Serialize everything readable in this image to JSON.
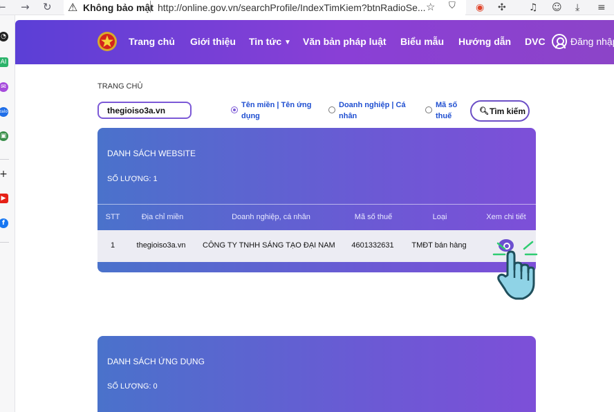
{
  "browser": {
    "back_icon": "arrow-left-icon",
    "forward_icon": "arrow-right-icon",
    "reload_icon": "reload-icon",
    "security_label": "Không bảo mật",
    "url": "http://online.gov.vn/searchProfile/IndexTimKiem?btnRadioSe..."
  },
  "header": {
    "nav_items": [
      "Trang chủ",
      "Giới thiệu",
      "Tin tức",
      "Văn bản pháp luật",
      "Biểu mẫu",
      "Hướng dẫn",
      "DVC"
    ],
    "login_label": "Đăng nhập"
  },
  "page": {
    "breadcrumb": "TRANG CHỦ",
    "search_value": "thegioiso3a.vn",
    "radios": [
      {
        "line1": "Tên miền | Tên ứng",
        "line2": "dụng",
        "selected": true
      },
      {
        "line1": "Doanh nghiệp | Cá",
        "line2": "nhân",
        "selected": false
      },
      {
        "line1": "Mã số",
        "line2": "thuế",
        "selected": false
      }
    ],
    "search_button": "Tìm kiếm"
  },
  "websites": {
    "title": "DANH SÁCH WEBSITE",
    "count_label": "SỐ LƯỢNG: 1",
    "columns": [
      "STT",
      "Địa chỉ miền",
      "Doanh nghiệp, cá nhân",
      "Mã số thuế",
      "Loại",
      "Xem chi tiết"
    ],
    "rows": [
      {
        "stt": "1",
        "domain": "thegioiso3a.vn",
        "company": "CÔNG TY TNHH SÁNG TẠO ĐẠI NAM",
        "tax": "4601332631",
        "type": "TMĐT bán hàng"
      }
    ]
  },
  "apps": {
    "title": "DANH SÁCH ỨNG DỤNG",
    "count_label": "SỐ LƯỢNG: 0"
  },
  "colors": {
    "header_gradient_start": "#5b3fd6",
    "header_gradient_end": "#8c44c8",
    "card_gradient_start": "#4a72cb",
    "card_gradient_end": "#7d4fd8",
    "accent": "#7b58d6",
    "hand_fill": "#8fd3e6",
    "click_rays": "#2ecc71"
  }
}
